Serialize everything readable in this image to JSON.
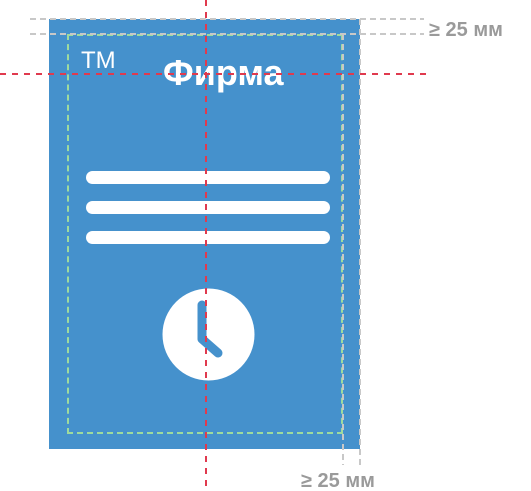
{
  "brand": {
    "trademark": "TM",
    "name": "Фирма"
  },
  "dimensions": {
    "top_label": "≥ 25 мм",
    "bottom_label": "≥ 25 мм"
  },
  "icons": {
    "clock": "clock-icon"
  },
  "colors": {
    "panel": "#4591cc",
    "center_guides": "#e03a4e",
    "safe_area": "#9edb9e",
    "dimension": "#9a9a9a",
    "text": "#ffffff"
  }
}
